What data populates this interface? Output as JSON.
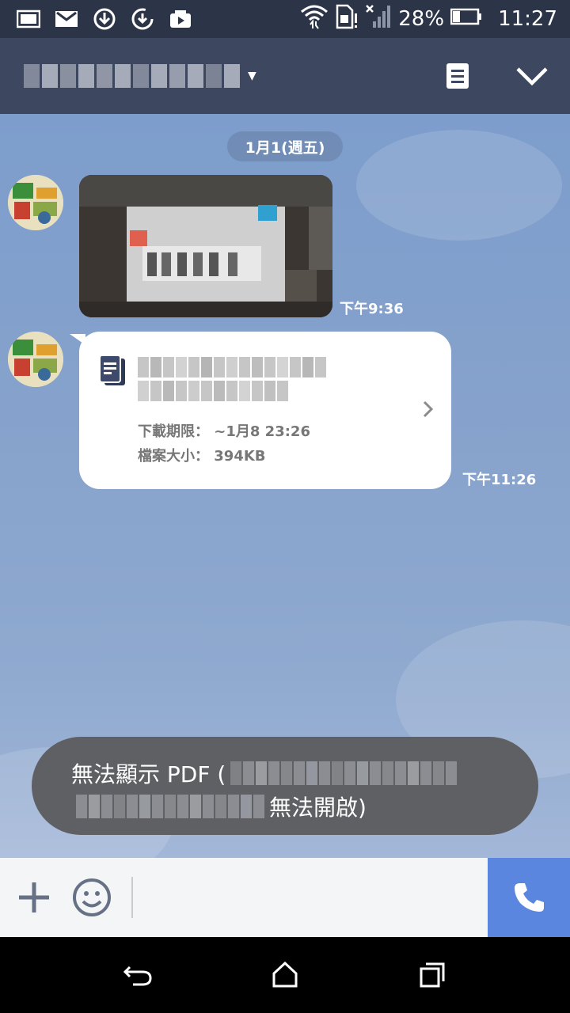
{
  "status_bar": {
    "icons_left": [
      "gallery-icon",
      "gmail-icon",
      "download-icon",
      "sync-icon",
      "video-icon"
    ],
    "battery": "28%",
    "time": "11:27"
  },
  "header": {
    "chat_title": "",
    "notes_icon": "notes-icon",
    "collapse_icon": "chevron-down-icon"
  },
  "chat": {
    "date_label": "1月1(週五)",
    "messages": [
      {
        "type": "photo",
        "time": "下午9:36"
      },
      {
        "type": "file",
        "time": "下午11:26",
        "expiry_label": "下載期限：",
        "expiry_value": "~1月8 23:26",
        "size_label": "檔案大小：",
        "size_value": "394KB"
      }
    ]
  },
  "toast": {
    "line1_prefix": "無法顯示 PDF (",
    "line2_suffix": "無法開啟)"
  },
  "colors": {
    "status_bg": "#2c3447",
    "header_bg": "#3d4760",
    "chat_bg": "#86a2cc",
    "call_button": "#5a86df",
    "toast_bg": "#5e6064"
  }
}
